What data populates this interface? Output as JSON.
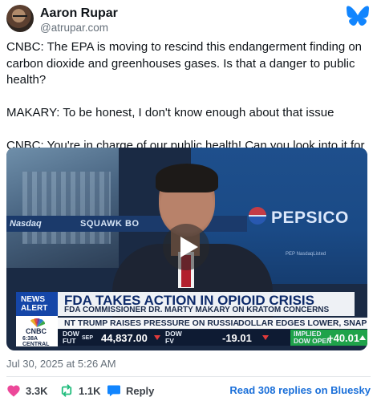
{
  "author": {
    "name": "Aaron Rupar",
    "handle": "@atrupar.com"
  },
  "post": {
    "paragraphs": [
      "CNBC: The EPA is moving to rescind this endangerment finding on carbon dioxide and greenhouses gases. Is that a danger to public health?",
      "MAKARY: To be honest, I don't know enough about that issue",
      "CNBC: You're in charge of our public health! Can you look into it for us?"
    ],
    "timestamp": "Jul 30, 2025 at 5:26 AM"
  },
  "video": {
    "ticker_top": {
      "nasdaq": "Nasdaq",
      "squawk": "SQUAWK BO"
    },
    "background_brand": "PEPSICO",
    "background_sub": "PEP NasdaqListed",
    "news_alert": "NEWS ALERT",
    "headline": "FDA TAKES ACTION IN OPIOID CRISIS",
    "subhead": "FDA COMMISSIONER DR. MARTY MAKARY ON KRATOM CONCERNS",
    "crawl": [
      "NT TRUMP RAISES PRESSURE ON RUSSIA",
      "DOLLAR EDGES LOWER, SNAPP"
    ],
    "network": "CNBC",
    "time": "6:38A",
    "time_zone": "CENTRAL",
    "markets": [
      {
        "label_1": "DOW",
        "label_2": "FUT",
        "month": "SEP",
        "value": "44,837.00",
        "direction": "down"
      },
      {
        "label_1": "DOW",
        "label_2": "FV",
        "month": "",
        "value": "-19.01",
        "direction": "down"
      },
      {
        "label_1": "IMPLIED",
        "label_2": "DOW OPEN",
        "month": "",
        "value": "+40.01",
        "direction": "up"
      }
    ]
  },
  "actions": {
    "likes": "3.3K",
    "reposts": "1.1K",
    "reply": "Reply",
    "read_replies": "Read 308 replies on Bluesky"
  },
  "colors": {
    "brand_blue": "#1185fe",
    "like_pink": "#ec4899",
    "repost_green": "#20bc7c",
    "link_blue": "#1a6fd9"
  }
}
